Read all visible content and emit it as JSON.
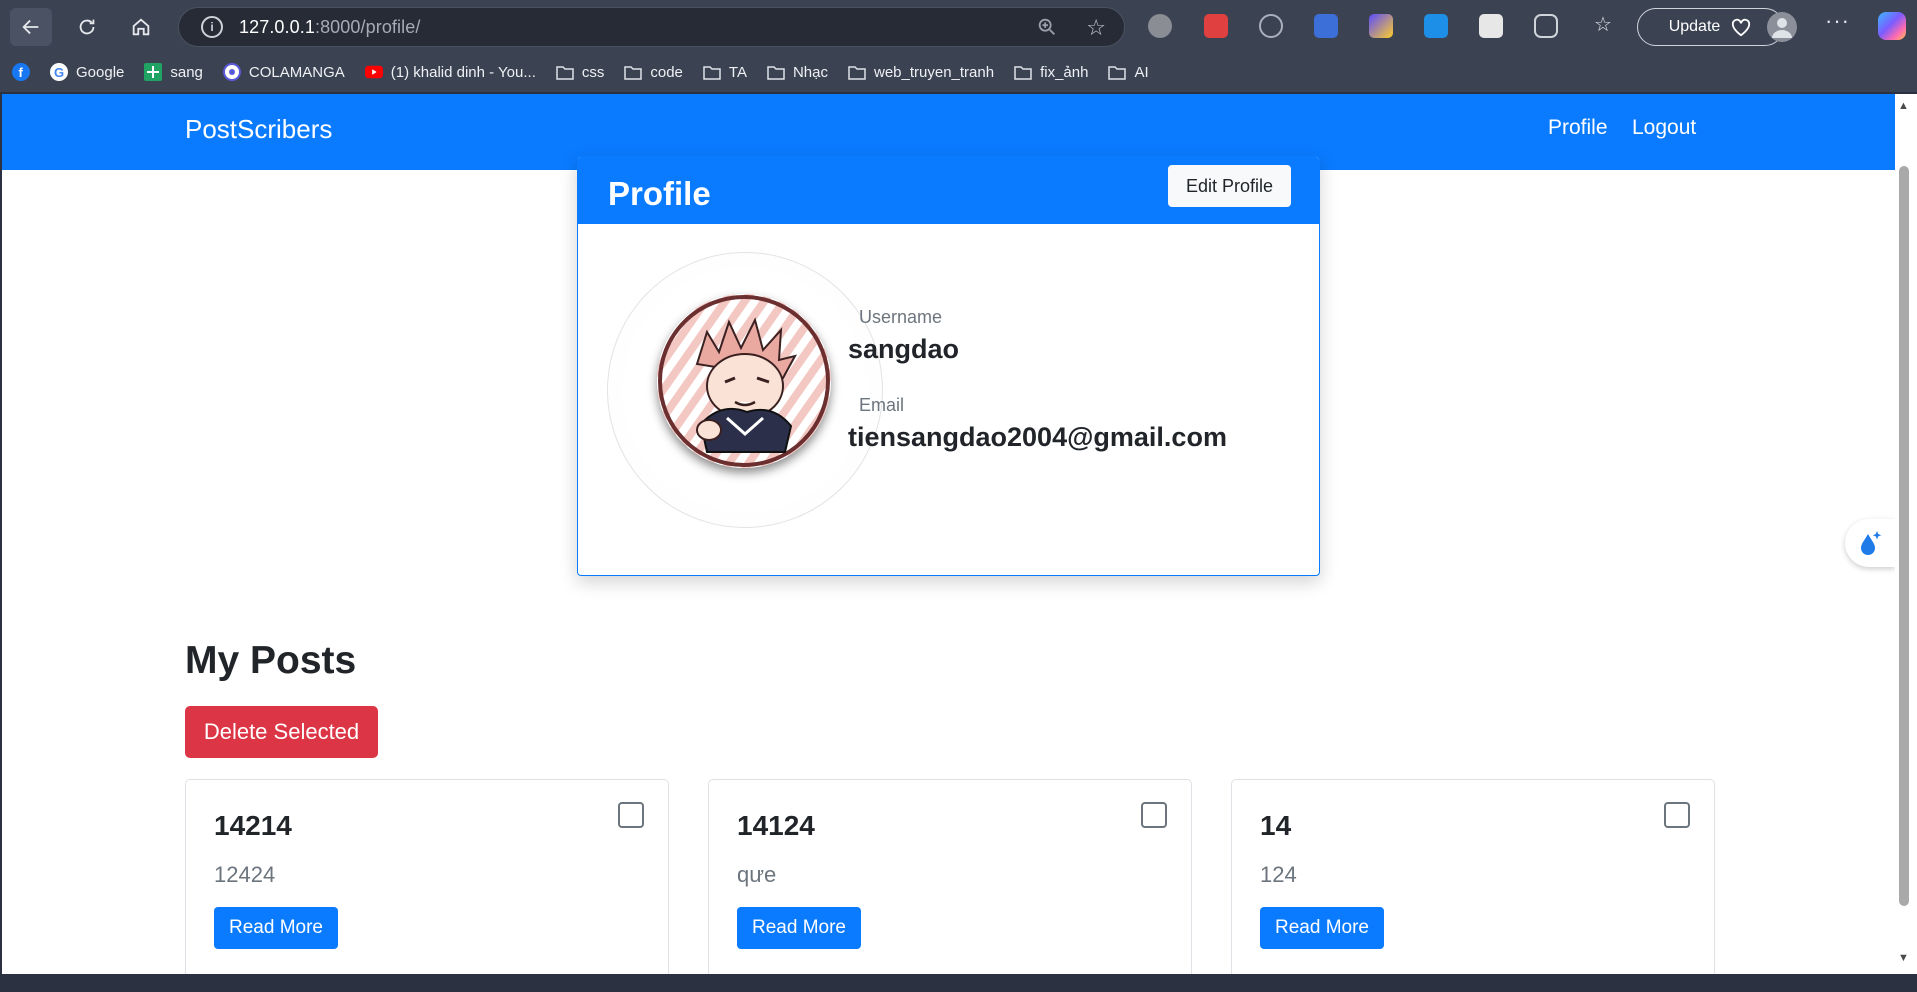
{
  "browser": {
    "url_host": "127.0.0.1",
    "url_path": ":8000/profile/",
    "update_label": "Update",
    "bookmarks": [
      {
        "label": "",
        "icon": "facebook-icon"
      },
      {
        "label": "Google",
        "icon": "google-icon"
      },
      {
        "label": "sang",
        "icon": "sheets-icon"
      },
      {
        "label": "COLAMANGA",
        "icon": "colamanga-icon"
      },
      {
        "label": "(1) khalid dinh - You...",
        "icon": "youtube-icon"
      },
      {
        "label": "css",
        "icon": "folder-icon"
      },
      {
        "label": "code",
        "icon": "folder-icon"
      },
      {
        "label": "TA",
        "icon": "folder-icon"
      },
      {
        "label": "Nhạc",
        "icon": "folder-icon"
      },
      {
        "label": "web_truyen_tranh",
        "icon": "folder-icon"
      },
      {
        "label": "fix_ảnh",
        "icon": "folder-icon"
      },
      {
        "label": "AI",
        "icon": "folder-icon"
      }
    ]
  },
  "navbar": {
    "brand": "PostScribers",
    "links": {
      "profile": "Profile",
      "logout": "Logout"
    }
  },
  "profile": {
    "title": "Profile",
    "edit_label": "Edit Profile",
    "username_label": "Username",
    "username": "sangdao",
    "email_label": "Email",
    "email": "tiensangdao2004@gmail.com"
  },
  "posts": {
    "title": "My Posts",
    "delete_label": "Delete Selected",
    "read_more_label": "Read More",
    "items": [
      {
        "title": "14214",
        "body": "12424"
      },
      {
        "title": "14124",
        "body": "qưe"
      },
      {
        "title": "14",
        "body": "124"
      }
    ]
  },
  "colors": {
    "primary": "#0a7bff",
    "danger": "#dc3545"
  }
}
